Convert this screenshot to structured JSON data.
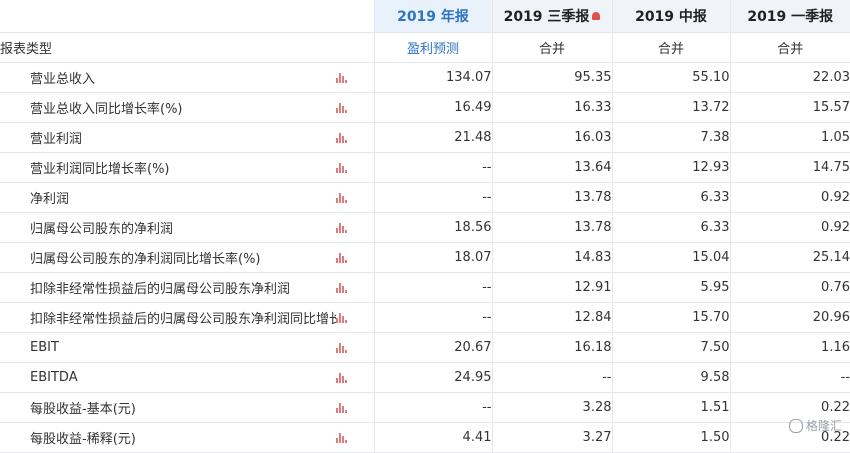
{
  "headers": {
    "label": "",
    "year": "2019 年报",
    "q3": "2019 三季报",
    "h1": "2019 中报",
    "q1": "2019 一季报"
  },
  "subheader": {
    "label": "报表类型",
    "year": "盈利预测",
    "q3": "合并",
    "h1": "合并",
    "q1": "合并"
  },
  "rows": [
    {
      "label": "营业总收入",
      "year": "134.07",
      "q3": "95.35",
      "h1": "55.10",
      "q1": "22.03"
    },
    {
      "label": "营业总收入同比增长率(%)",
      "year": "16.49",
      "q3": "16.33",
      "h1": "13.72",
      "q1": "15.57"
    },
    {
      "label": "营业利润",
      "year": "21.48",
      "q3": "16.03",
      "h1": "7.38",
      "q1": "1.05"
    },
    {
      "label": "营业利润同比增长率(%)",
      "year": "--",
      "q3": "13.64",
      "h1": "12.93",
      "q1": "14.75"
    },
    {
      "label": "净利润",
      "year": "--",
      "q3": "13.78",
      "h1": "6.33",
      "q1": "0.92"
    },
    {
      "label": "归属母公司股东的净利润",
      "year": "18.56",
      "q3": "13.78",
      "h1": "6.33",
      "q1": "0.92"
    },
    {
      "label": "归属母公司股东的净利润同比增长率(%)",
      "year": "18.07",
      "q3": "14.83",
      "h1": "15.04",
      "q1": "25.14"
    },
    {
      "label": "扣除非经常性损益后的归属母公司股东净利润",
      "year": "--",
      "q3": "12.91",
      "h1": "5.95",
      "q1": "0.76"
    },
    {
      "label": "扣除非经常性损益后的归属母公司股东净利润同比增长率",
      "year": "--",
      "q3": "12.84",
      "h1": "15.70",
      "q1": "20.96"
    },
    {
      "label": "EBIT",
      "year": "20.67",
      "q3": "16.18",
      "h1": "7.50",
      "q1": "1.16"
    },
    {
      "label": "EBITDA",
      "year": "24.95",
      "q3": "--",
      "h1": "9.58",
      "q1": "--"
    },
    {
      "label": "每股收益-基本(元)",
      "year": "--",
      "q3": "3.28",
      "h1": "1.51",
      "q1": "0.22"
    },
    {
      "label": "每股收益-稀释(元)",
      "year": "4.41",
      "q3": "3.27",
      "h1": "1.50",
      "q1": "0.22"
    }
  ],
  "icons": {
    "row_chart": "bar-chart-icon",
    "q3_flag": "bell-icon"
  },
  "colors": {
    "accent": "#2d74c4",
    "header_bg": "#f0f3f8",
    "icon": "#e07b7b",
    "border": "#e4e8ee"
  },
  "watermark": "格隆汇"
}
